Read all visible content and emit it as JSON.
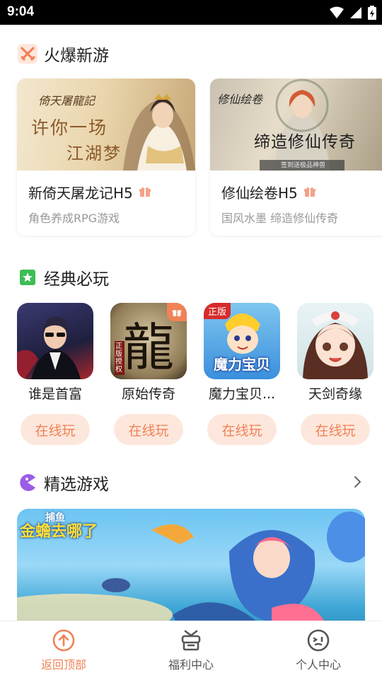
{
  "status_bar": {
    "time": "9:04"
  },
  "sections": {
    "hot": {
      "title": "火爆新游"
    },
    "classic": {
      "title": "经典必玩"
    },
    "featured": {
      "title": "精选游戏"
    }
  },
  "hot_games": [
    {
      "name": "新倚天屠龙记H5",
      "desc": "角色养成RPG游戏",
      "banner_title": "倚天屠龍記",
      "banner_text1": "许你一场",
      "banner_text2": "江湖梦"
    },
    {
      "name": "修仙绘卷H5",
      "desc": "国风水墨 缔造修仙传奇",
      "banner_title": "修仙绘卷",
      "banner_text1": "缔造修仙传奇",
      "banner_text2": "签到送极品神兽"
    }
  ],
  "classic_games": [
    {
      "name": "谁是首富",
      "play": "在线玩"
    },
    {
      "name": "原始传奇",
      "play": "在线玩",
      "thumb_text": "龍",
      "thumb_sub": "正版授权"
    },
    {
      "name": "魔力宝贝...",
      "play": "在线玩",
      "thumb_text": "魔力宝贝",
      "badge": "正版"
    },
    {
      "name": "天剑奇缘",
      "play": "在线玩"
    }
  ],
  "featured_banner": {
    "text_top": "捕鱼",
    "text_main": "金蟾去哪了"
  },
  "tabbar": [
    {
      "label": "返回顶部",
      "active": true
    },
    {
      "label": "福利中心",
      "active": false
    },
    {
      "label": "个人中心",
      "active": false
    }
  ],
  "colors": {
    "accent": "#f08257",
    "play_bg": "#fde7dc",
    "inactive": "#555555"
  }
}
